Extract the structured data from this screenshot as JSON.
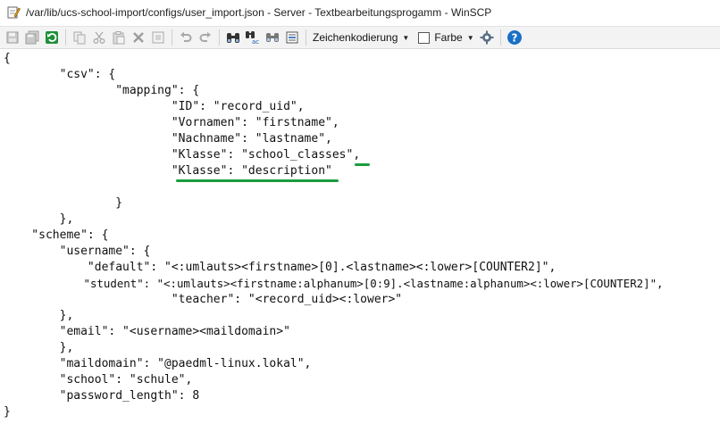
{
  "window": {
    "title": "/var/lib/ucs-school-import/configs/user_import.json - Server - Textbearbeitungsprogamm - WinSCP"
  },
  "toolbar": {
    "buttons": [
      {
        "name": "save-icon"
      },
      {
        "name": "save-all-icon"
      },
      {
        "name": "reload-icon"
      },
      {
        "name": "copy-icon"
      },
      {
        "name": "cut-icon"
      },
      {
        "name": "paste-icon"
      },
      {
        "name": "delete-icon"
      },
      {
        "name": "select-all-icon"
      },
      {
        "name": "undo-icon"
      },
      {
        "name": "redo-icon"
      },
      {
        "name": "find-icon"
      },
      {
        "name": "replace-icon"
      },
      {
        "name": "find-next-icon"
      },
      {
        "name": "goto-line-icon"
      }
    ],
    "encoding_label": "Zeichenkodierung",
    "color_label": "Farbe",
    "accent": "#1a6fc6"
  },
  "editor": {
    "highlight_color": "#1a9c3e",
    "lines": [
      "{",
      "        \"csv\": {",
      "                \"mapping\": {",
      "                        \"ID\": \"record_uid\",",
      "                        \"Vornamen\": \"firstname\",",
      "                        \"Nachname\": \"lastname\",",
      "                        \"Klasse\": \"school_classes\",",
      "                        \"Klasse\": \"description\"",
      "",
      "                }",
      "        },",
      "    \"scheme\": {",
      "        \"username\": {",
      "            \"default\": \"<:umlauts><firstname>[0].<lastname><:lower>[COUNTER2]\",",
      "            \"student\": \"<:umlauts><firstname:alphanum>[0:9].<lastname:alphanum><:lower>[COUNTER2]\",",
      "                        \"teacher\": \"<record_uid><:lower>\"",
      "        },",
      "        \"email\": \"<username><maildomain>\"",
      "        },",
      "        \"maildomain\": \"@paedml-linux.lokal\",",
      "        \"school\": \"schule\",",
      "        \"password_length\": 8",
      "}"
    ]
  }
}
